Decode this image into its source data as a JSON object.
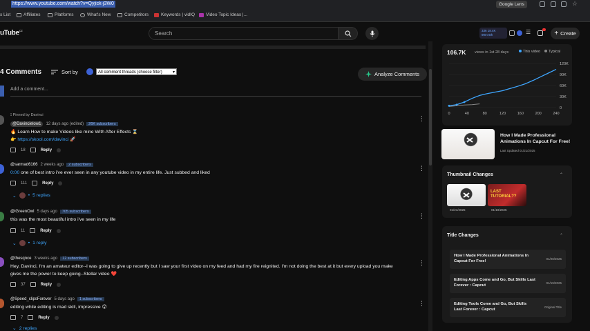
{
  "browser": {
    "url": "https://www.youtube.com/watch?v=Qyjick-j3W0",
    "google_lens": "Google Lens",
    "bookmarks": [
      "s List",
      "Affiliates",
      "Platforms",
      "What's New",
      "Competitors",
      "Keywords | vidIQ",
      "Video Topic Ideas |..."
    ]
  },
  "header": {
    "logo": "uTube",
    "search_placeholder": "Search",
    "stat_line1": "336  18.4K",
    "stat_line2": "90m   6th",
    "create_label": "Create"
  },
  "comments": {
    "count_label": "4 Comments",
    "sort_label": "Sort by",
    "filter_value": "All comment threads (choose filter)",
    "analyze_label": "Analyze Comments",
    "add_placeholder": "Add a comment...",
    "pinned_label": "Pinned by Davinci",
    "items": [
      {
        "handle": "@Davincielow1",
        "time": "12 days ago (edited)",
        "subs": "26K subscribers",
        "line1": "🔥 Learn How to make Videos like mine With After Effects ⌛",
        "line2_prefix": "👉 ",
        "link": "https://skool.com/davinci",
        "line2_suffix": " 🚀",
        "likes": "18",
        "reply": "Reply"
      },
      {
        "handle": "@sarmad6166",
        "time": "2 weeks ago",
        "subs": "2 subscribers",
        "timestamp": "0:00",
        "text": " one of best intro i've ever seen in any youtube video in my entire life. Just subbed and liked",
        "likes": "111",
        "reply": "Reply",
        "replies": "5 replies"
      },
      {
        "handle": "@iGreenOwl",
        "time": "5 days ago",
        "subs": "705 subscribers",
        "text": "this was the most beautiful intro i've seen in my life",
        "likes": "11",
        "reply": "Reply",
        "replies": "1 reply"
      },
      {
        "handle": "@thesqnce",
        "time": "3 weeks ago",
        "subs": "12 subscribers",
        "line1": "Hey, Davinci, I'm an amateur editor--I was going to give up  recently but I saw your first video on my feed and had my fire reignited. I'm not doing the best at it but every upload you make",
        "line2": "gives me the power to keep going--Stellar video ❤️",
        "likes": "37",
        "reply": "Reply"
      },
      {
        "handle": "@Speed_clipsForever",
        "time": "5 days ago",
        "subs": "1 subscribers",
        "text": "editing while editing is mad skill, impressive 😮",
        "likes": "7",
        "reply": "Reply",
        "replies": "2 replies"
      }
    ]
  },
  "panel": {
    "views": "106.7K",
    "views_sub": "views in 1st 28 days",
    "legend_this": "This video",
    "legend_typical": "Typical",
    "chart_data": {
      "type": "line",
      "x": [
        0,
        2,
        4,
        6,
        8,
        10,
        12,
        14,
        16,
        18,
        20,
        22,
        24,
        26,
        28
      ],
      "series": [
        {
          "name": "This video",
          "values": [
            5,
            8,
            15,
            25,
            33,
            38,
            42,
            46,
            52,
            58,
            65,
            74,
            84,
            94,
            104
          ]
        }
      ],
      "typical_values": [
        3,
        5,
        7,
        8,
        10
      ],
      "xticks": [
        "0",
        "40",
        "80",
        "120",
        "160",
        "200",
        "240"
      ],
      "yticks": [
        "0",
        "30K",
        "60K",
        "90K",
        "120K"
      ],
      "xlim": [
        0,
        28
      ],
      "ylim": [
        0,
        120
      ]
    },
    "chart_colors": {
      "this": "#3ea6ff",
      "typical": "#888888"
    },
    "video_title": "How I Made Professional Animations In Capcut For Free!",
    "video_updated": "Last Updated 01/21/2025",
    "thumbnail_section": "Thumbnail Changes",
    "thumbnails": [
      {
        "date": "01/21/2025"
      },
      {
        "date": "01/19/2025",
        "overlay": "LAST TUTORIAL??"
      }
    ],
    "title_section": "Title Changes",
    "titles": [
      {
        "text": "How I Made Professional Animations In Capcut For Free!",
        "date": "01/20/2025"
      },
      {
        "text": "Editing Apps Come and Go, But Skills Last Forever : Capcut",
        "date": "01/19/2025"
      },
      {
        "text": "Editing Tools Come and Go, But Skills Last Forever : Capcut",
        "date": "Original Title"
      }
    ]
  }
}
